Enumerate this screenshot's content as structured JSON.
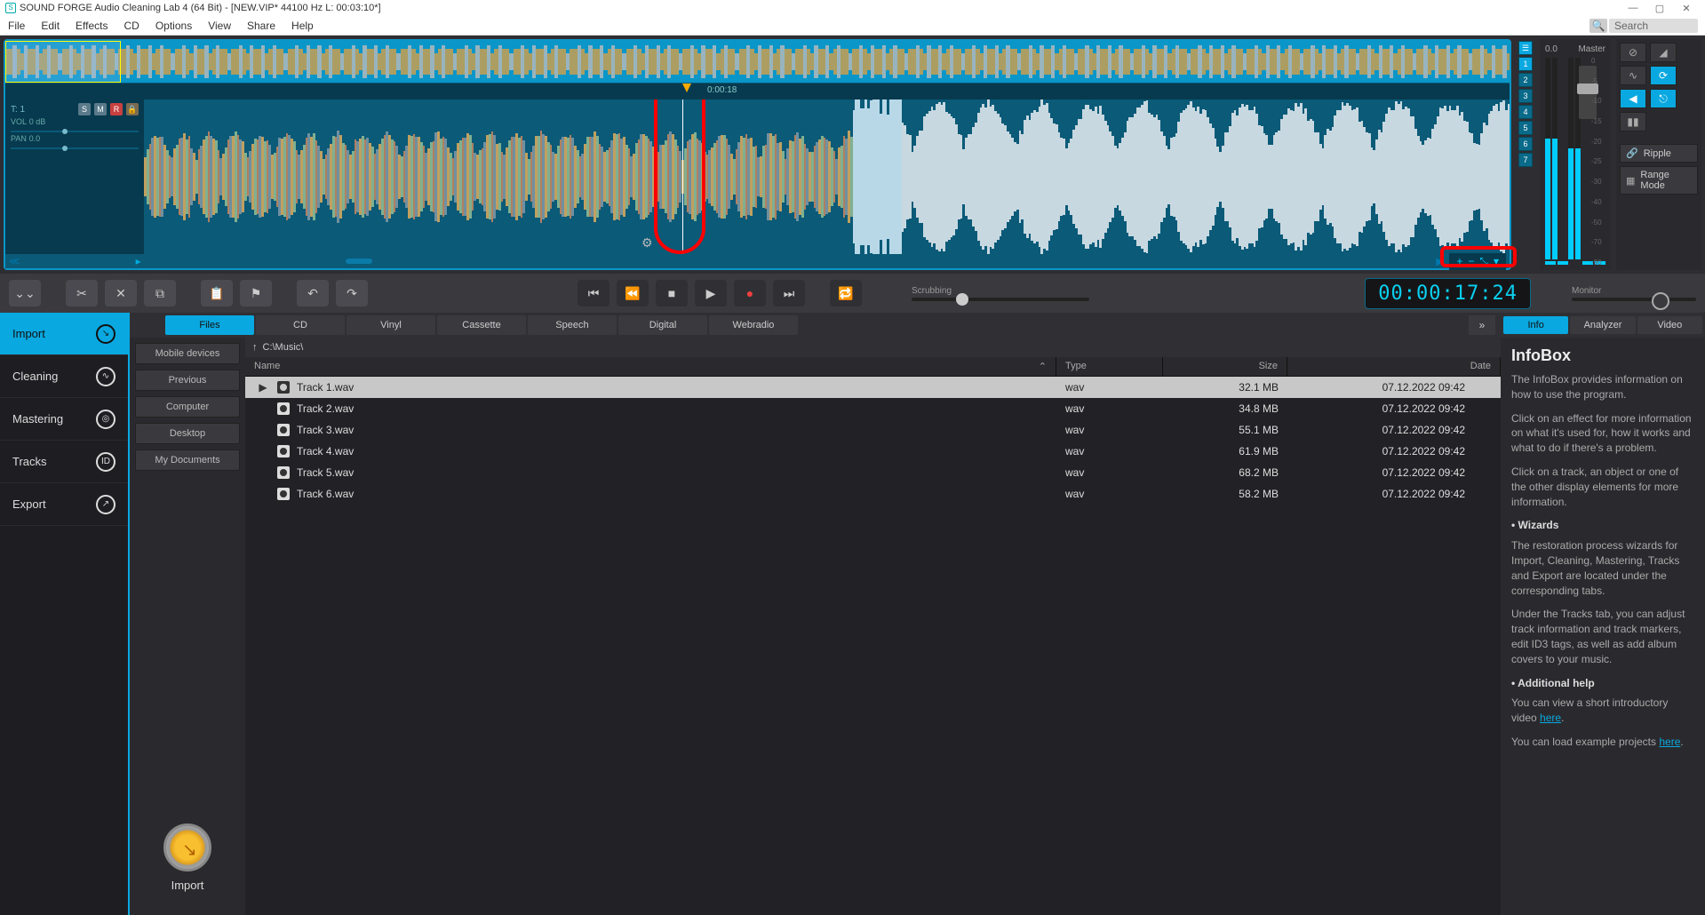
{
  "titlebar": {
    "title": "SOUND FORGE Audio Cleaning Lab 4 (64 Bit) - [NEW.VIP*  44100 Hz L: 00:03:10*]"
  },
  "menu": {
    "items": [
      "File",
      "Edit",
      "Effects",
      "CD",
      "Options",
      "View",
      "Share",
      "Help"
    ],
    "search_placeholder": "Search"
  },
  "editor": {
    "timeline_marker": "0:00:18",
    "track": {
      "label": "T: 1",
      "vol_label": "VOL",
      "vol_value": "0 dB",
      "pan_label": "PAN",
      "pan_value": "0.0"
    },
    "track_buttons": [
      "☰",
      "1",
      "2",
      "3",
      "4",
      "5",
      "6",
      "7"
    ],
    "zoom_buttons": [
      "+",
      "−",
      "⤡",
      "▾"
    ]
  },
  "meter": {
    "db": "0.0",
    "label": "Master",
    "scale": [
      "0",
      "-5",
      "-10",
      "-15",
      "-20",
      "-25",
      "-30",
      "-40",
      "-50",
      "-70",
      "-90"
    ]
  },
  "tools": {
    "ripple": "Ripple",
    "range": "Range Mode"
  },
  "transport": {
    "scrubbing_label": "Scrubbing",
    "timecode": "00:00:17:24",
    "monitor_label": "Monitor"
  },
  "sidebar": {
    "items": [
      {
        "label": "Import",
        "icon": "↘"
      },
      {
        "label": "Cleaning",
        "icon": "∿"
      },
      {
        "label": "Mastering",
        "icon": "◎"
      },
      {
        "label": "Tracks",
        "icon": "ID"
      },
      {
        "label": "Export",
        "icon": "↗"
      }
    ]
  },
  "sources": {
    "tabs": [
      "Files",
      "CD",
      "Vinyl",
      "Cassette",
      "Speech",
      "Digital",
      "Webradio"
    ]
  },
  "locations": [
    "Mobile devices",
    "Previous",
    "Computer",
    "Desktop",
    "My Documents"
  ],
  "browser": {
    "path": "C:\\Music\\",
    "columns": {
      "name": "Name",
      "type": "Type",
      "size": "Size",
      "date": "Date"
    },
    "rows": [
      {
        "name": "Track 1.wav",
        "type": "wav",
        "size": "32.1 MB",
        "date": "07.12.2022 09:42",
        "selected": true
      },
      {
        "name": "Track 2.wav",
        "type": "wav",
        "size": "34.8 MB",
        "date": "07.12.2022 09:42"
      },
      {
        "name": "Track 3.wav",
        "type": "wav",
        "size": "55.1 MB",
        "date": "07.12.2022 09:42"
      },
      {
        "name": "Track 4.wav",
        "type": "wav",
        "size": "61.9 MB",
        "date": "07.12.2022 09:42"
      },
      {
        "name": "Track 5.wav",
        "type": "wav",
        "size": "68.2 MB",
        "date": "07.12.2022 09:42"
      },
      {
        "name": "Track 6.wav",
        "type": "wav",
        "size": "58.2 MB",
        "date": "07.12.2022 09:42"
      }
    ],
    "big_button": "Import"
  },
  "infobox": {
    "tabs": [
      "Info",
      "Analyzer",
      "Video"
    ],
    "title": "InfoBox",
    "p1": "The InfoBox provides information on how to use the program.",
    "p2": "Click on an effect for more information on what it's used for, how it works and what to do if there's a problem.",
    "p3": "Click on a track, an object or one of the other display elements for more information.",
    "b1": "• Wizards",
    "p4": "The restoration process wizards for Import, Cleaning, Mastering, Tracks and Export are located under the corresponding tabs.",
    "p5": "Under the Tracks tab, you can adjust track information and track markers, edit ID3 tags, as well as add album covers to your music.",
    "b2": "• Additional help",
    "p6a": "You can view a short introductory video ",
    "p6link": "here",
    "p6b": ".",
    "p7a": "You can load example projects ",
    "p7link": "here",
    "p7b": "."
  }
}
